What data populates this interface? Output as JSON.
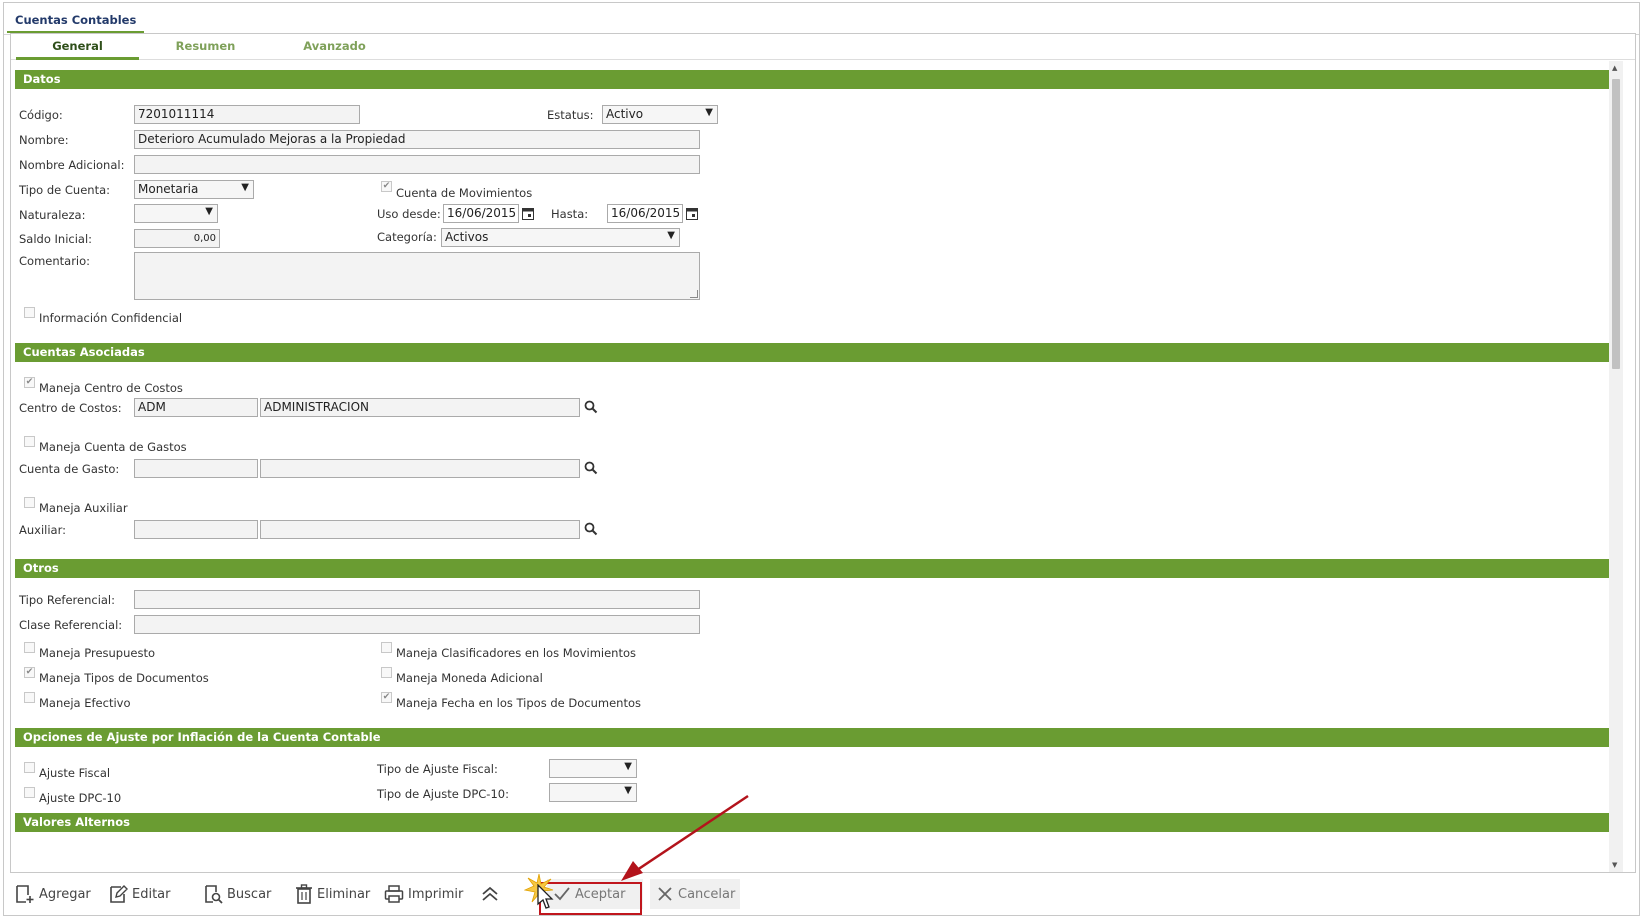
{
  "window": {
    "title": "Cuentas Contables"
  },
  "tabs": [
    {
      "label": "General",
      "active": true
    },
    {
      "label": "Resumen",
      "active": false
    },
    {
      "label": "Avanzado",
      "active": false
    }
  ],
  "sections": {
    "datos": "Datos",
    "cuentas_asociadas": "Cuentas Asociadas",
    "otros": "Otros",
    "ajuste": "Opciones de Ajuste por Inflación de la Cuenta Contable",
    "valores_alternos": "Valores Alternos"
  },
  "datos": {
    "codigo_label": "Código:",
    "codigo_value": "7201011114",
    "estatus_label": "Estatus:",
    "estatus_value": "Activo",
    "nombre_label": "Nombre:",
    "nombre_value": "Deterioro Acumulado Mejoras a la Propiedad",
    "nombre_adicional_label": "Nombre Adicional:",
    "nombre_adicional_value": "",
    "tipo_cuenta_label": "Tipo de Cuenta:",
    "tipo_cuenta_value": "Monetaria",
    "cuenta_movimientos_label": "Cuenta de Movimientos",
    "cuenta_movimientos_checked": true,
    "naturaleza_label": "Naturaleza:",
    "naturaleza_value": "",
    "uso_desde_label": "Uso desde:",
    "uso_desde_value": "16/06/2015",
    "hasta_label": "Hasta:",
    "hasta_value": "16/06/2015",
    "saldo_inicial_label": "Saldo Inicial:",
    "saldo_inicial_value": "0,00",
    "categoria_label": "Categoría:",
    "categoria_value": "Activos",
    "comentario_label": "Comentario:",
    "info_confidencial_label": "Información Confidencial",
    "info_confidencial_checked": false
  },
  "cuentas_asociadas": {
    "maneja_centro_label": "Maneja Centro de Costos",
    "maneja_centro_checked": true,
    "centro_label": "Centro de Costos:",
    "centro_code": "ADM",
    "centro_desc": "ADMINISTRACION",
    "maneja_gastos_label": "Maneja Cuenta de Gastos",
    "maneja_gastos_checked": false,
    "gasto_label": "Cuenta de Gasto:",
    "gasto_code": "",
    "gasto_desc": "",
    "maneja_auxiliar_label": "Maneja Auxiliar",
    "maneja_auxiliar_checked": false,
    "auxiliar_label": "Auxiliar:",
    "auxiliar_code": "",
    "auxiliar_desc": ""
  },
  "otros": {
    "tipo_ref_label": "Tipo Referencial:",
    "tipo_ref_value": "",
    "clase_ref_label": "Clase Referencial:",
    "clase_ref_value": "",
    "presupuesto_label": "Maneja Presupuesto",
    "presupuesto_checked": false,
    "tipos_doc_label": "Maneja Tipos de Documentos",
    "tipos_doc_checked": true,
    "efectivo_label": "Maneja Efectivo",
    "efectivo_checked": false,
    "clasificadores_label": "Maneja Clasificadores en los Movimientos",
    "clasificadores_checked": false,
    "moneda_label": "Maneja Moneda Adicional",
    "moneda_checked": false,
    "fecha_label": "Maneja Fecha en los Tipos de Documentos",
    "fecha_checked": true
  },
  "ajuste": {
    "fiscal_label": "Ajuste Fiscal",
    "fiscal_checked": false,
    "dpc_label": "Ajuste DPC-10",
    "dpc_checked": false,
    "tipo_fiscal_label": "Tipo de Ajuste Fiscal:",
    "tipo_fiscal_value": "",
    "tipo_dpc_label": "Tipo de Ajuste DPC-10:",
    "tipo_dpc_value": ""
  },
  "toolbar": {
    "agregar": "Agregar",
    "editar": "Editar",
    "buscar": "Buscar",
    "eliminar": "Eliminar",
    "imprimir": "Imprimir",
    "aceptar": "Aceptar",
    "cancelar": "Cancelar"
  },
  "icons": {
    "dropdown": "▼",
    "check": "✔"
  },
  "colors": {
    "section_bg": "#6a9c32",
    "highlight_red": "#c0161d"
  }
}
